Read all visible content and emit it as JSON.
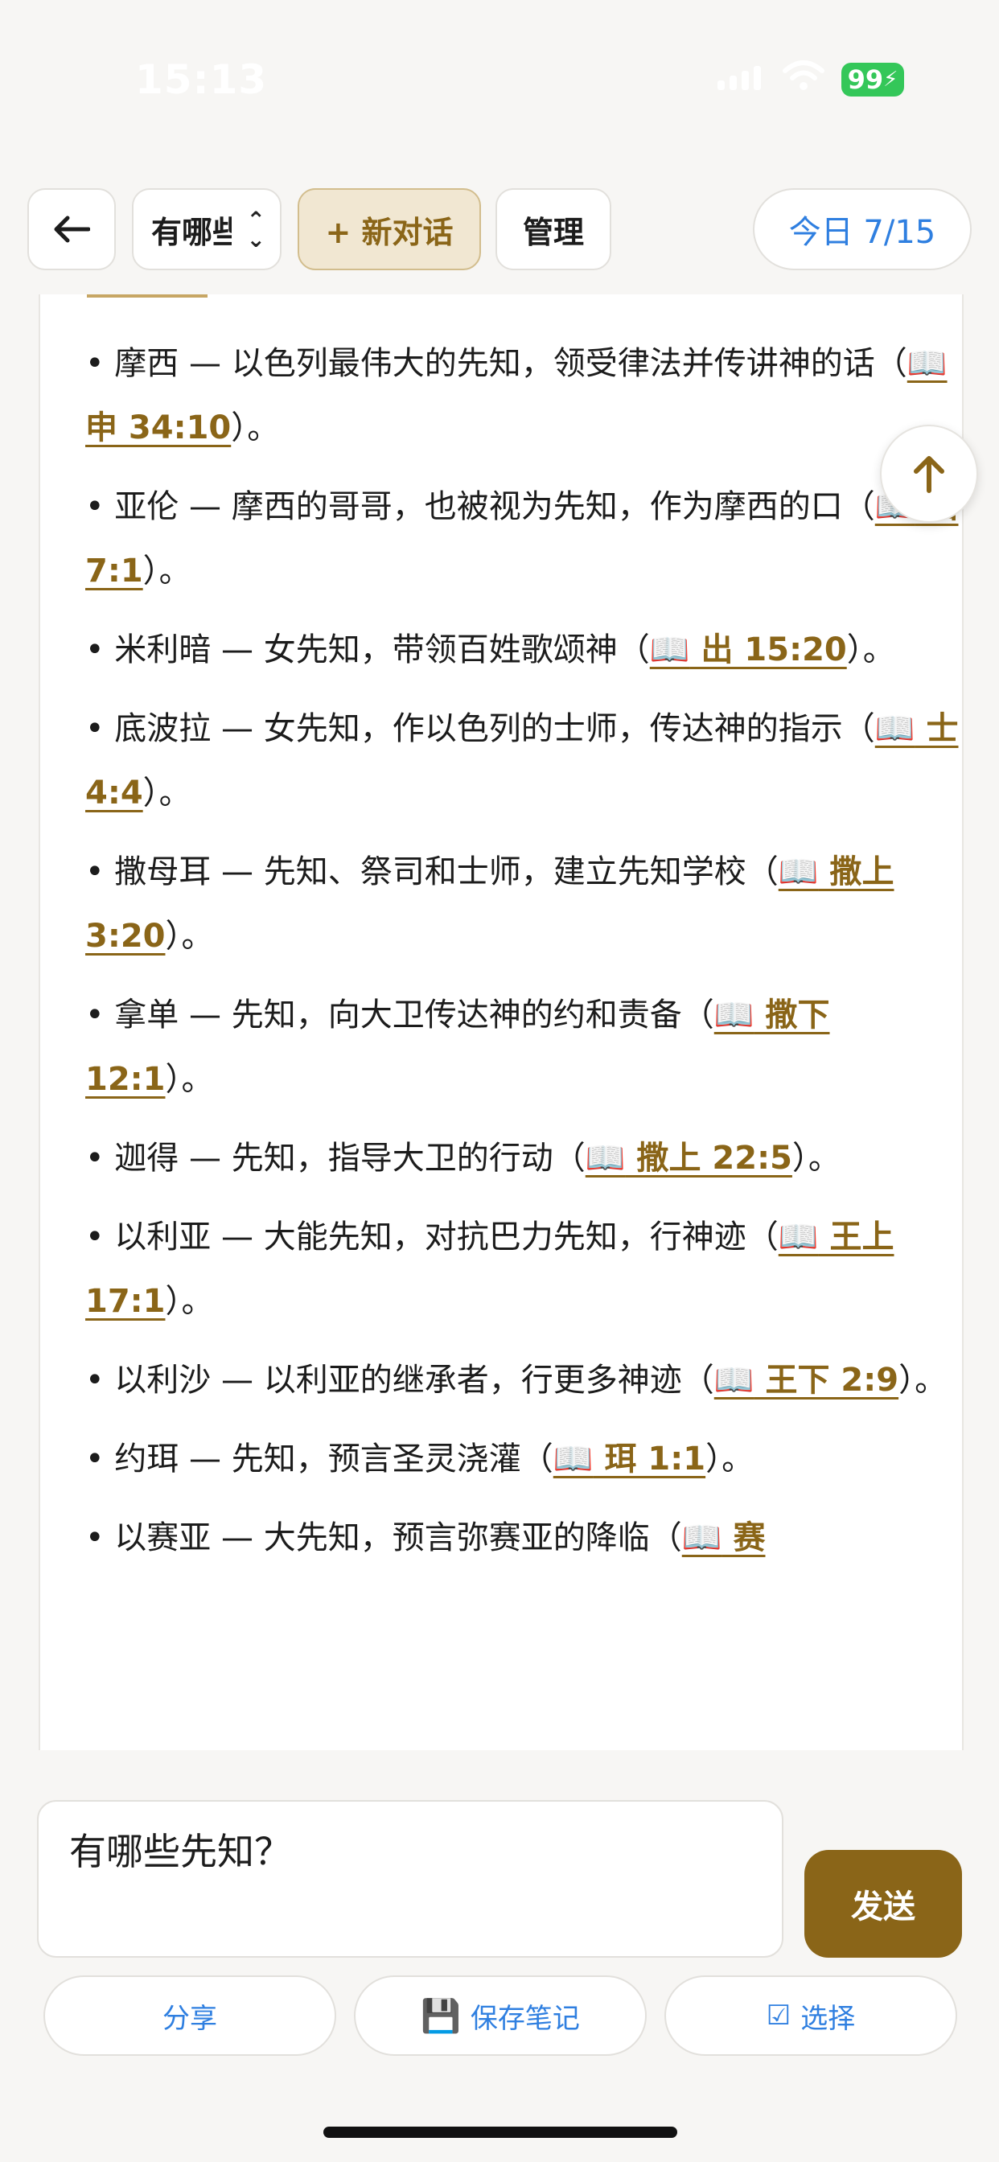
{
  "status_bar": {
    "time": "15:13",
    "battery": "99"
  },
  "toolbar": {
    "back_icon": "arrow-left-icon",
    "conversation_title": "有哪些先知？",
    "new_chat_label": "+ 新对话",
    "manage_label": "管理",
    "today_label": "今日 7/15"
  },
  "prophets": [
    {
      "text": "• 摩西 — 以色列最伟大的先知，领受律法并传讲神的话（",
      "ref": "申 34:10",
      "tail": "）。"
    },
    {
      "text": "• 亚伦 — 摩西的哥哥，也被视为先知，作为摩西的口（",
      "ref": "出 7:1",
      "tail": "）。"
    },
    {
      "text": "• 米利暗 — 女先知，带领百姓歌颂神（",
      "ref": "出 15:20",
      "tail": "）。"
    },
    {
      "text": "• 底波拉 — 女先知，作以色列的士师，传达神的指示（",
      "ref": "士 4:4",
      "tail": "）。"
    },
    {
      "text": "• 撒母耳 — 先知、祭司和士师，建立先知学校（",
      "ref": "撒上 3:20",
      "tail": "）。"
    },
    {
      "text": "• 拿单 — 先知，向大卫传达神的约和责备（",
      "ref": "撒下 12:1",
      "tail": "）。"
    },
    {
      "text": "• 迦得 — 先知，指导大卫的行动（",
      "ref": "撒上 22:5",
      "tail": "）。"
    },
    {
      "text": "• 以利亚 — 大能先知，对抗巴力先知，行神迹（",
      "ref": "王上 17:1",
      "tail": "）。"
    },
    {
      "text": "• 以利沙 — 以利亚的继承者，行更多神迹（",
      "ref": "王下 2:9",
      "tail": "）。"
    },
    {
      "text": "• 约珥 — 先知，预言圣灵浇灌（",
      "ref": "珥 1:1",
      "tail": "）。"
    },
    {
      "text": "• 以赛亚 — 大先知，预言弥赛亚的降临（",
      "ref": "赛",
      "tail": ""
    }
  ],
  "book_glyph": "📖",
  "input": {
    "value": "有哪些先知？"
  },
  "send_label": "发送",
  "actions": {
    "share_label": "分享",
    "save_label": "保存笔记",
    "save_icon": "💾",
    "select_label": "选择",
    "select_icon": "☑"
  },
  "colors": {
    "accent": "#8a6518",
    "link_blue": "#2f7fe0",
    "new_chat_bg": "#f1e7d2"
  }
}
